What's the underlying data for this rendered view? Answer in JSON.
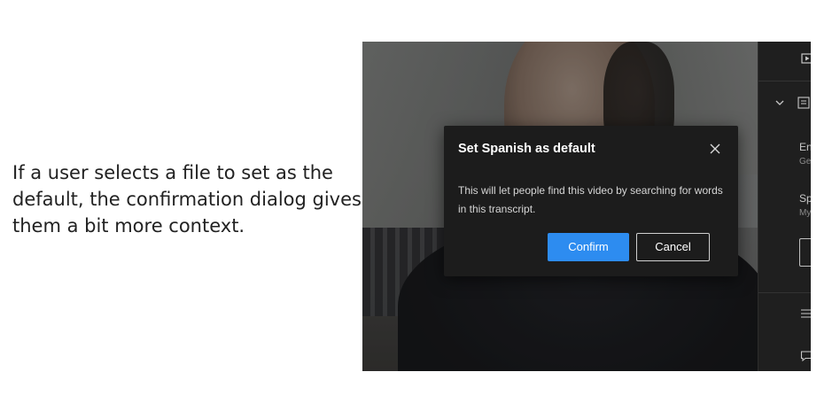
{
  "caption": {
    "text": "If a user selects a file to set as the default, the confirmation dialog gives them a bit more context."
  },
  "dialog": {
    "title": "Set Spanish as default",
    "close_icon": "close-icon",
    "body": "This will let people find this video by searching for words in this transcript.",
    "confirm_label": "Confirm",
    "cancel_label": "Cancel"
  },
  "side_panel": {
    "item1_label": "En",
    "item1_sub": "Ge",
    "item2_label": "Sp",
    "item2_sub": "My",
    "icons": [
      "play-icon",
      "chevron-down-icon",
      "transcript-icon",
      "menu-icon",
      "comment-icon"
    ]
  },
  "colors": {
    "confirm_button": "#2d8cf0",
    "dialog_background": "#1c1c1c",
    "panel_background": "#1f1f1f"
  }
}
